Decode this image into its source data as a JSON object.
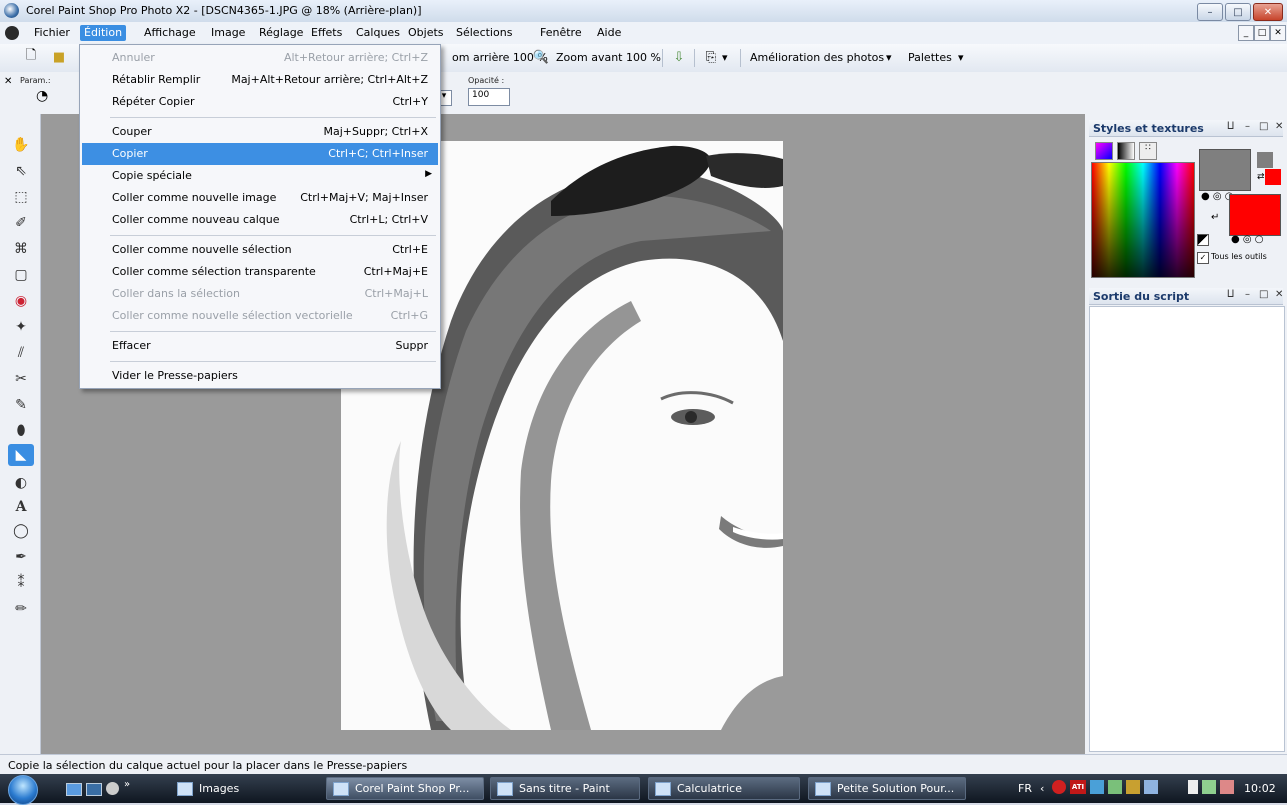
{
  "window": {
    "title": "Corel Paint Shop Pro Photo X2 - [DSCN4365-1.JPG @ 18% (Arrière-plan)]"
  },
  "menubar": [
    "Fichier",
    "Édition",
    "Affichage",
    "Image",
    "Réglage",
    "Effets",
    "Calques",
    "Objets",
    "Sélections",
    "Fenêtre",
    "Aide"
  ],
  "toolbar": {
    "zoom_out": "om arrière 100 %",
    "zoom_in": "Zoom avant 100 %",
    "enhance": "Amélioration des photos",
    "palettes": "Palettes"
  },
  "options": {
    "param_label": "Param.:",
    "opacity_label": "Opacité :",
    "opacity_value": "100"
  },
  "edit_menu": [
    {
      "label": "Annuler",
      "shortcut": "Alt+Retour arrière; Ctrl+Z",
      "disabled": true
    },
    {
      "label": "Rétablir Remplir",
      "shortcut": "Maj+Alt+Retour arrière; Ctrl+Alt+Z"
    },
    {
      "label": "Répéter Copier",
      "shortcut": "Ctrl+Y"
    },
    {
      "label": "Couper",
      "shortcut": "Maj+Suppr; Ctrl+X"
    },
    {
      "label": "Copier",
      "shortcut": "Ctrl+C; Ctrl+Inser",
      "highlighted": true
    },
    {
      "label": "Copie spéciale",
      "shortcut": ""
    },
    {
      "label": "Coller comme nouvelle image",
      "shortcut": "Ctrl+Maj+V; Maj+Inser"
    },
    {
      "label": "Coller comme nouveau calque",
      "shortcut": "Ctrl+L; Ctrl+V"
    },
    {
      "label": "Coller comme nouvelle sélection",
      "shortcut": "Ctrl+E"
    },
    {
      "label": "Coller comme sélection transparente",
      "shortcut": "Ctrl+Maj+E"
    },
    {
      "label": "Coller dans la sélection",
      "shortcut": "Ctrl+Maj+L",
      "disabled": true
    },
    {
      "label": "Coller comme nouvelle sélection vectorielle",
      "shortcut": "Ctrl+G",
      "disabled": true
    },
    {
      "label": "Effacer",
      "shortcut": "Suppr"
    },
    {
      "label": "Vider le Presse-papiers",
      "shortcut": ""
    }
  ],
  "styles_palette": {
    "title": "Styles et textures",
    "all_tools": "Tous les outils",
    "fg_color": "#7f7f7f",
    "bg_color": "#ff0000"
  },
  "script_palette": {
    "title": "Sortie du script"
  },
  "status": "Copie la sélection du calque actuel pour la placer dans le Presse-papiers",
  "taskbar": {
    "images": "Images",
    "tasks": [
      "Corel Paint Shop Pr...",
      "Sans titre - Paint",
      "Calculatrice",
      "Petite Solution Pour..."
    ],
    "lang": "FR",
    "clock": "10:02"
  },
  "icons": [
    "app-icon",
    "new-doc-icon",
    "open-folder-icon",
    "zoom-icon",
    "pan-icon",
    "selection-icon",
    "brush-icon",
    "text-icon"
  ]
}
